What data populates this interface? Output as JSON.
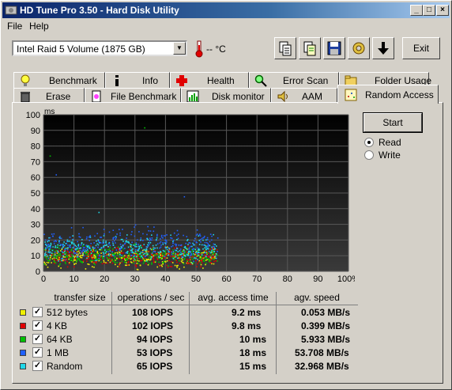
{
  "window": {
    "title": "HD Tune Pro 3.50 - Hard Disk Utility"
  },
  "menu": [
    "File",
    "Help"
  ],
  "toolbar": {
    "drive": "Intel   Raid 5 Volume (1875 GB)",
    "temperature": "-- °C",
    "exit_label": "Exit",
    "icons": [
      "copy-text-icon",
      "copy-info-icon",
      "save-icon",
      "options-icon",
      "download-icon"
    ]
  },
  "tabs_top": [
    {
      "label": "Benchmark",
      "icon": "lightbulb-icon"
    },
    {
      "label": "Info",
      "icon": "info-icon"
    },
    {
      "label": "Health",
      "icon": "health-cross-icon"
    },
    {
      "label": "Error Scan",
      "icon": "magnifier-icon"
    },
    {
      "label": "Folder Usage",
      "icon": "folder-icon"
    }
  ],
  "tabs_bottom": [
    {
      "label": "Erase",
      "icon": "trash-icon"
    },
    {
      "label": "File Benchmark",
      "icon": "file-benchmark-icon"
    },
    {
      "label": "Disk monitor",
      "icon": "monitor-chart-icon"
    },
    {
      "label": "AAM",
      "icon": "speaker-icon"
    },
    {
      "label": "Random Access",
      "icon": "random-access-icon",
      "active": true
    }
  ],
  "controls": {
    "start_label": "Start",
    "read_label": "Read",
    "write_label": "Write",
    "selected": "Read"
  },
  "colors": {
    "chart_bg": "#000000",
    "grid": "#505050",
    "512_bytes": "#f0f000",
    "4kb": "#e00000",
    "64kb": "#00c000",
    "1mb": "#2060ff",
    "random": "#20d8e8"
  },
  "table": {
    "headers": [
      "transfer size",
      "operations / sec",
      "avg. access time",
      "agv. speed"
    ],
    "rows": [
      {
        "size": "512 bytes",
        "ops": "108 IOPS",
        "time": "9.2 ms",
        "speed": "0.053 MB/s",
        "color": "#f0f000"
      },
      {
        "size": "4 KB",
        "ops": "102 IOPS",
        "time": "9.8 ms",
        "speed": "0.399 MB/s",
        "color": "#e00000"
      },
      {
        "size": "64 KB",
        "ops": "94 IOPS",
        "time": "10 ms",
        "speed": "5.933 MB/s",
        "color": "#00c000"
      },
      {
        "size": "1 MB",
        "ops": "53 IOPS",
        "time": "18 ms",
        "speed": "53.708 MB/s",
        "color": "#2060ff"
      },
      {
        "size": "Random",
        "ops": "65 IOPS",
        "time": "15 ms",
        "speed": "32.968 MB/s",
        "color": "#20d8e8"
      }
    ]
  },
  "chart_data": {
    "type": "scatter",
    "ylabel": "ms",
    "ylim": [
      0,
      100
    ],
    "xlim": [
      0,
      100
    ],
    "y_ticks": [
      "0",
      "10",
      "20",
      "30",
      "40",
      "50",
      "60",
      "70",
      "80",
      "90",
      "100"
    ],
    "x_ticks": [
      "0",
      "10",
      "20",
      "30",
      "40",
      "50",
      "60",
      "70",
      "80",
      "90",
      "100%"
    ],
    "grid": true,
    "series": [
      {
        "name": "512 bytes",
        "x_range": [
          0,
          57
        ],
        "y_mean": 9.2
      },
      {
        "name": "4 KB",
        "x_range": [
          0,
          57
        ],
        "y_mean": 9.8
      },
      {
        "name": "64 KB",
        "x_range": [
          0,
          57
        ],
        "y_mean": 10
      },
      {
        "name": "1 MB",
        "x_range": [
          0,
          57
        ],
        "y_mean": 18
      },
      {
        "name": "Random",
        "x_range": [
          0,
          57
        ],
        "y_mean": 15
      }
    ]
  }
}
